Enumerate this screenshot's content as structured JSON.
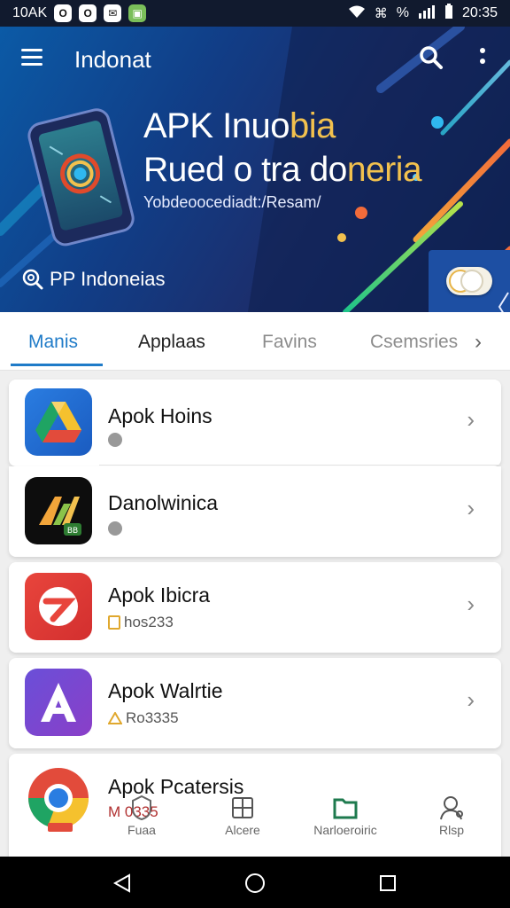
{
  "status_bar": {
    "left_text": "10AK",
    "time": "20:35",
    "signal_text": "%"
  },
  "app_bar": {
    "title": "Indonat",
    "icons": [
      "menu-icon",
      "search-icon",
      "more-vert-icon"
    ]
  },
  "hero": {
    "title_line1": "APK Inuobia",
    "title_line2": "Rued o tra doneria",
    "subtitle": "Yobdeoocediadt:/Resam/",
    "search_label": "PP Indoneias",
    "accent_color": "#f2c14e"
  },
  "tabs": {
    "items": [
      {
        "label": "Manis",
        "active": true
      },
      {
        "label": "Applaas",
        "active": false
      },
      {
        "label": "Favins",
        "active": false
      },
      {
        "label": "Csemsries",
        "active": false
      }
    ],
    "active_color": "#1f7bc8"
  },
  "apps": [
    {
      "name": "Apok Hoins",
      "meta": "",
      "icon": "google-drive-icon"
    },
    {
      "name": "Danolwinica",
      "meta": "",
      "icon": "apk-logo-icon"
    },
    {
      "name": "Apok Ibicra",
      "meta": "hos233",
      "icon": "red-app-icon"
    },
    {
      "name": "Apok Walrtie",
      "meta": "Ro3335",
      "icon": "letter-a-icon"
    },
    {
      "name": "Apok Pcatersis",
      "meta": "M 0335",
      "icon": "chrome-icon"
    }
  ],
  "bottom_nav": {
    "items": [
      {
        "label": "Fuaa",
        "icon": "shield-icon"
      },
      {
        "label": "Alcere",
        "icon": "grid-box-icon"
      },
      {
        "label": "Narloeroiric",
        "icon": "folder-icon"
      },
      {
        "label": "Rlsp",
        "icon": "user-icon"
      }
    ]
  },
  "nav_bar": {
    "icons": [
      "back-icon",
      "home-icon",
      "recents-icon"
    ]
  }
}
